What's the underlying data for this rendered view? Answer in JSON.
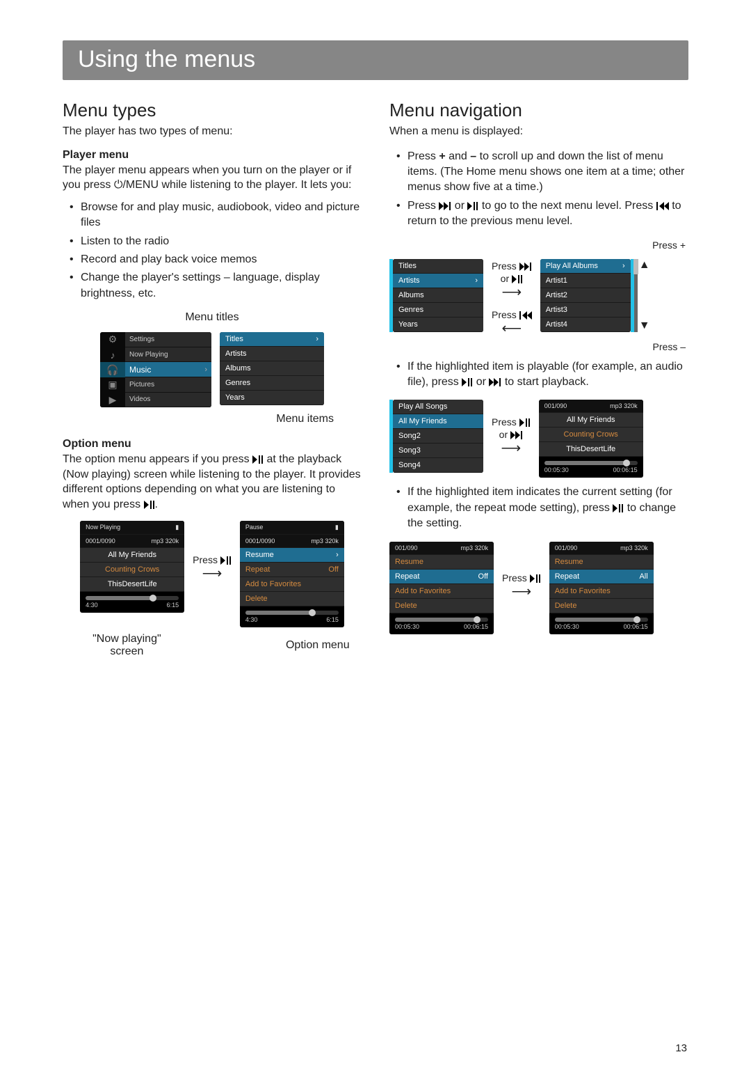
{
  "page_number": "13",
  "banner": "Using the menus",
  "left": {
    "heading": "Menu types",
    "intro": "The player has two types of menu:",
    "player_menu_h": "Player menu",
    "player_menu_p": "The player menu appears when you turn on the player or if you press ⏻/MENU while listening to the player. It lets you:",
    "player_menu_list": [
      "Browse for and play music, audiobook, video and picture files",
      "Listen to the radio",
      "Record and play back voice memos",
      "Change the player's settings – language, display brightness, etc."
    ],
    "menu_titles_caption": "Menu titles",
    "menu_items_caption": "Menu items",
    "home_menu": {
      "items": [
        "Settings",
        "Now Playing",
        "Music",
        "Pictures",
        "Videos"
      ],
      "selected_index": 2
    },
    "music_menu": {
      "title": "Titles",
      "items": [
        "Artists",
        "Albums",
        "Genres",
        "Years"
      ]
    },
    "option_menu_h": "Option menu",
    "option_menu_p_pre": "The option menu appears if you press ",
    "option_menu_p_mid": " at the playback (Now playing) screen while listening to the player. It provides different options depending on what you are listening to when you press ",
    "now_playing_caption": "\"Now playing\" screen",
    "option_menu_caption": "Option menu",
    "press_playpause_label": "Press ",
    "now_playing_screen": {
      "title": "Now Playing",
      "counter": "0001/0090",
      "codec": "mp3 320k",
      "track": "All My Friends",
      "artist": "Counting Crows",
      "album": "ThisDesertLife",
      "elapsed": "4:30",
      "total": "6:15",
      "progress_pct": 72
    },
    "option_screen": {
      "title": "Pause",
      "counter": "0001/0090",
      "codec": "mp3 320k",
      "items": [
        {
          "label": "Resume",
          "value": "",
          "selected": true
        },
        {
          "label": "Repeat",
          "value": "Off",
          "selected": false
        },
        {
          "label": "Add to Favorites",
          "value": "",
          "selected": false
        },
        {
          "label": "Delete",
          "value": "",
          "selected": false
        }
      ],
      "elapsed": "4:30",
      "total": "6:15",
      "progress_pct": 72
    }
  },
  "right": {
    "heading": "Menu navigation",
    "intro": "When a menu is displayed:",
    "bul1_pre": "Press ",
    "bul1_plus": "+",
    "bul1_mid": " and ",
    "bul1_minus": "–",
    "bul1_post": " to scroll up and down the list of menu items. (The Home menu shows one item at a time; other menus show five at a time.)",
    "bul2_a": "Press ",
    "bul2_b": " or ",
    "bul2_c": " to go to the next menu level. Press ",
    "bul2_d": " to return to the previous menu level.",
    "press_plus": "Press +",
    "press_minus": "Press –",
    "press_fwd_or_pp_a": "Press ",
    "press_fwd_or_pp_b": "or ",
    "press_prev": "Press ",
    "nav_menu_a": {
      "items": [
        {
          "label": "Titles",
          "selected": false
        },
        {
          "label": "Artists",
          "selected": true
        },
        {
          "label": "Albums",
          "selected": false
        },
        {
          "label": "Genres",
          "selected": false
        },
        {
          "label": "Years",
          "selected": false
        }
      ]
    },
    "nav_menu_b": {
      "items": [
        {
          "label": "Play All Albums",
          "selected": true
        },
        {
          "label": "Artist1",
          "selected": false
        },
        {
          "label": "Artist2",
          "selected": false
        },
        {
          "label": "Artist3",
          "selected": false
        },
        {
          "label": "Artist4",
          "selected": false
        }
      ]
    },
    "bul3_a": "If the highlighted item is playable (for example, an audio file), press ",
    "bul3_b": " or ",
    "bul3_c": " to start playback.",
    "songs_menu": {
      "items": [
        {
          "label": "Play All Songs",
          "selected": false
        },
        {
          "label": "All My Friends",
          "selected": true
        },
        {
          "label": "Song2",
          "selected": false
        },
        {
          "label": "Song3",
          "selected": false
        },
        {
          "label": "Song4",
          "selected": false
        }
      ]
    },
    "press_pp_or_fwd_a": "Press ",
    "press_pp_or_fwd_b": "or ",
    "play_screen": {
      "counter": "001/090",
      "codec": "mp3 320k",
      "track": "All My Friends",
      "artist": "Counting Crows",
      "album": "ThisDesertLife",
      "elapsed": "00:05:30",
      "total": "00:06:15",
      "progress_pct": 88
    },
    "bul4_a": "If the highlighted item indicates the current setting (for example, the repeat mode setting), press ",
    "bul4_b": " to change the setting.",
    "repeat_a": {
      "counter": "001/090",
      "codec": "mp3 320k",
      "items": [
        {
          "label": "Resume",
          "value": "",
          "selected": false
        },
        {
          "label": "Repeat",
          "value": "Off",
          "selected": true
        },
        {
          "label": "Add to Favorites",
          "value": "",
          "selected": false
        },
        {
          "label": "Delete",
          "value": "",
          "selected": false
        }
      ],
      "elapsed": "00:05:30",
      "total": "00:06:15",
      "progress_pct": 88
    },
    "press_pp_label": "Press ",
    "repeat_b": {
      "counter": "001/090",
      "codec": "mp3 320k",
      "items": [
        {
          "label": "Resume",
          "value": "",
          "selected": false
        },
        {
          "label": "Repeat",
          "value": "All",
          "selected": true
        },
        {
          "label": "Add to Favorites",
          "value": "",
          "selected": false
        },
        {
          "label": "Delete",
          "value": "",
          "selected": false
        }
      ],
      "elapsed": "00:05:30",
      "total": "00:06:15",
      "progress_pct": 88
    }
  },
  "icons": {
    "play_pause": "▶❚❚",
    "next": "▶▶❙",
    "prev": "❙◀◀",
    "power": "⏻",
    "battery": "▯"
  }
}
